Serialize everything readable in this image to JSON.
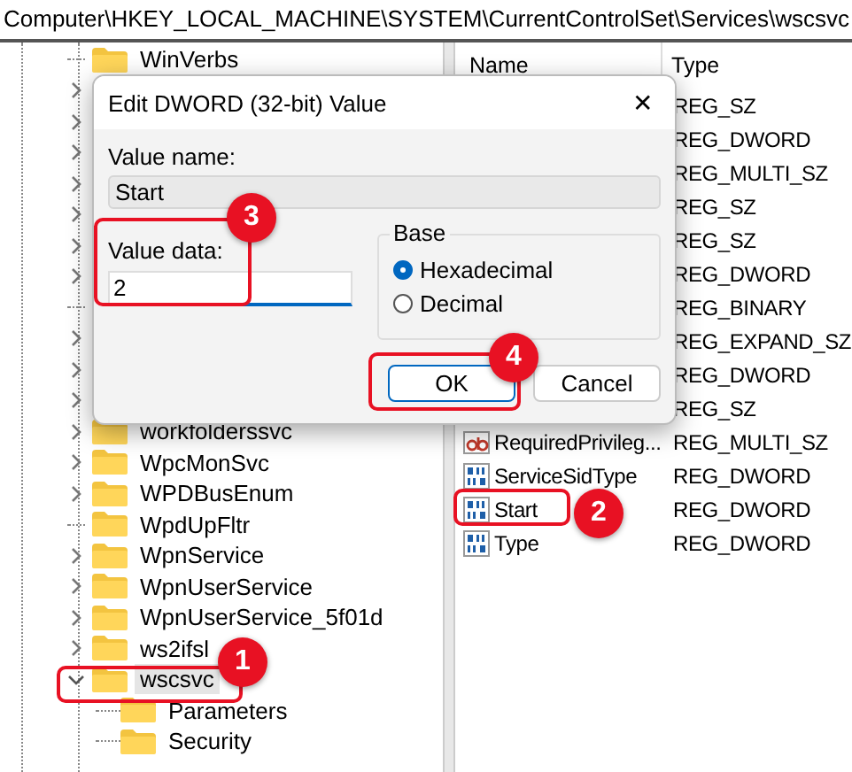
{
  "address_bar": "Computer\\HKEY_LOCAL_MACHINE\\SYSTEM\\CurrentControlSet\\Services\\wscsvc",
  "tree": {
    "items": [
      {
        "name": "WinVerbs",
        "expandable": false,
        "selected": false
      },
      {
        "expandable": true,
        "expanded": false
      },
      {
        "expandable": true,
        "expanded": false
      },
      {
        "expandable": true,
        "expanded": false
      },
      {
        "expandable": true,
        "expanded": false
      },
      {
        "expandable": true,
        "expanded": false
      },
      {
        "expandable": true,
        "expanded": false
      },
      {
        "expandable": true,
        "expanded": false
      },
      {
        "expandable": false
      },
      {
        "expandable": true,
        "expanded": false
      },
      {
        "expandable": true,
        "expanded": false
      },
      {
        "expandable": true,
        "expanded": false
      },
      {
        "name": "workfolderssvc",
        "expandable": true,
        "expanded": false,
        "selected": false
      },
      {
        "name": "WpcMonSvc",
        "expandable": true,
        "expanded": false,
        "selected": false
      },
      {
        "name": "WPDBusEnum",
        "expandable": true,
        "expanded": false,
        "selected": false
      },
      {
        "name": "WpdUpFltr",
        "expandable": false,
        "selected": false
      },
      {
        "name": "WpnService",
        "expandable": true,
        "expanded": false,
        "selected": false
      },
      {
        "name": "WpnUserService",
        "expandable": true,
        "expanded": false,
        "selected": false
      },
      {
        "name": "WpnUserService_5f01d",
        "expandable": true,
        "expanded": false,
        "selected": false
      },
      {
        "name": "ws2ifsl",
        "expandable": true,
        "expanded": false,
        "selected": false
      },
      {
        "name": "wscsvc",
        "expandable": true,
        "expanded": true,
        "selected": true,
        "children": [
          {
            "name": "Parameters",
            "expandable": false,
            "selected": false
          },
          {
            "name": "Security",
            "expandable": false,
            "selected": false
          }
        ]
      }
    ]
  },
  "values": {
    "columns": [
      "Name",
      "Type"
    ],
    "rows": [
      {
        "type": "REG_SZ"
      },
      {
        "type": "REG_DWORD"
      },
      {
        "type": "REG_MULTI_SZ"
      },
      {
        "type": "REG_SZ"
      },
      {
        "type": "REG_SZ"
      },
      {
        "type": "REG_DWORD"
      },
      {
        "type": "REG_BINARY"
      },
      {
        "type": "REG_EXPAND_SZ"
      },
      {
        "type": "REG_DWORD"
      },
      {
        "type": "REG_SZ"
      },
      {
        "kind": "string",
        "name": "RequiredPrivileg...",
        "type": "REG_MULTI_SZ"
      },
      {
        "kind": "binary",
        "name": "ServiceSidType",
        "type": "REG_DWORD"
      },
      {
        "kind": "binary",
        "name": "Start",
        "type": "REG_DWORD"
      },
      {
        "kind": "binary",
        "name": "Type",
        "type": "REG_DWORD"
      }
    ]
  },
  "dialog": {
    "title": "Edit DWORD (32-bit) Value",
    "close": "✕",
    "value_name_label": "Value name:",
    "value_name": "Start",
    "value_data_label": "Value data:",
    "value_data": "2",
    "base": {
      "label": "Base",
      "options": [
        {
          "label": "Hexadecimal",
          "selected": true
        },
        {
          "label": "Decimal",
          "selected": false
        }
      ]
    },
    "buttons": [
      {
        "label": "OK",
        "default": true
      },
      {
        "label": "Cancel",
        "default": false
      }
    ]
  },
  "callouts": [
    {
      "number": "1"
    },
    {
      "number": "2"
    },
    {
      "number": "3"
    },
    {
      "number": "4"
    }
  ]
}
